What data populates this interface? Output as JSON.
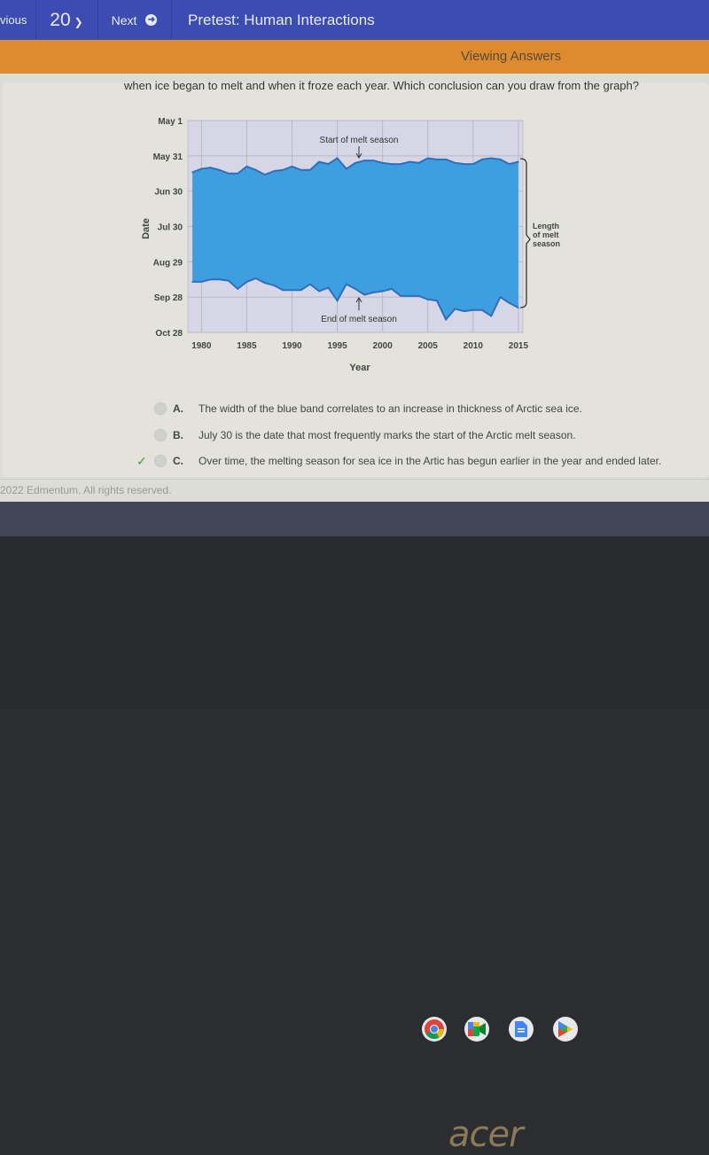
{
  "topbar": {
    "previous_label": "vious",
    "question_number": "20",
    "next_label": "Next",
    "title": "Pretest: Human Interactions"
  },
  "status_bar": {
    "label": "Viewing Answers"
  },
  "question": {
    "text_visible": "when ice began to melt and when it froze each year. Which conclusion can you draw from the graph?"
  },
  "chart_data": {
    "type": "area",
    "title": "",
    "xlabel": "Year",
    "ylabel": "Date",
    "x_ticks": [
      "1980",
      "1985",
      "1990",
      "1995",
      "2000",
      "2005",
      "2010",
      "2015"
    ],
    "y_ticks": [
      "May 1",
      "May 31",
      "Jun 30",
      "Jul 30",
      "Aug 29",
      "Sep 28",
      "Oct 28"
    ],
    "y_unit": "days after May 1",
    "ylim": [
      0,
      180
    ],
    "xlim": [
      1978.5,
      2015.5
    ],
    "grid": true,
    "annotations": {
      "start": "Start of melt season",
      "end": "End of melt season",
      "length": "Length of melt season"
    },
    "x": [
      1979,
      1980,
      1981,
      1982,
      1983,
      1984,
      1985,
      1986,
      1987,
      1988,
      1989,
      1990,
      1991,
      1992,
      1993,
      1994,
      1995,
      1996,
      1997,
      1998,
      1999,
      2000,
      2001,
      2002,
      2003,
      2004,
      2005,
      2006,
      2007,
      2008,
      2009,
      2010,
      2011,
      2012,
      2013,
      2014,
      2015
    ],
    "series": [
      {
        "name": "Start of melt season",
        "values": [
          44,
          41,
          40,
          42,
          45,
          45,
          39,
          42,
          46,
          43,
          42,
          39,
          42,
          42,
          35,
          37,
          32,
          41,
          36,
          34,
          34,
          36,
          37,
          37,
          35,
          36,
          32,
          33,
          33,
          36,
          37,
          37,
          33,
          32,
          33,
          37,
          35
        ]
      },
      {
        "name": "End of melt season",
        "values": [
          137,
          137,
          135,
          135,
          136,
          143,
          137,
          134,
          138,
          140,
          144,
          144,
          144,
          139,
          145,
          142,
          153,
          139,
          143,
          148,
          146,
          145,
          143,
          149,
          149,
          149,
          152,
          153,
          169,
          160,
          162,
          161,
          161,
          166,
          150,
          155,
          159
        ]
      }
    ],
    "colors": {
      "band": "#3d9ee0",
      "line": "#2f6fb8",
      "background": "#d6d6e6",
      "grid": "#b8b8c8"
    }
  },
  "options": [
    {
      "letter": "A.",
      "text": "The width of the blue band correlates to an increase in thickness of Arctic sea ice.",
      "correct": false
    },
    {
      "letter": "B.",
      "text": "July 30 is the date that most frequently marks the start of the Arctic melt season.",
      "correct": false
    },
    {
      "letter": "C.",
      "text": "Over time, the melting season for sea ice in the Artic has begun earlier in the year and ended later.",
      "correct": true
    }
  ],
  "footer": {
    "copyright": "2022 Edmentum. All rights reserved."
  },
  "shelf": {
    "apps": [
      "chrome-icon",
      "meet-icon",
      "docs-icon",
      "play-store-icon"
    ]
  },
  "device": {
    "brand": "acer"
  }
}
